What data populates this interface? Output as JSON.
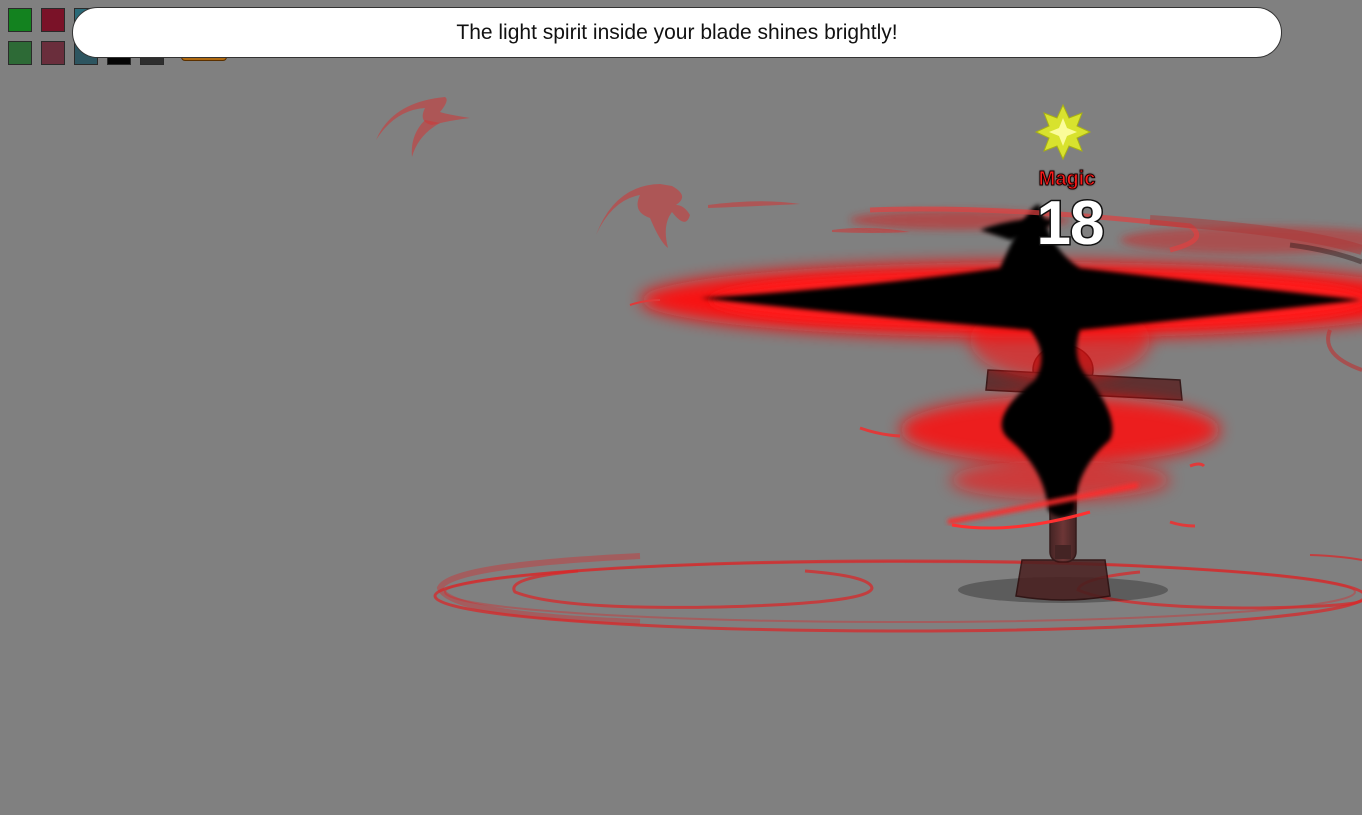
{
  "message": {
    "text": "The light spirit inside your blade shines brightly!"
  },
  "swatches": [
    {
      "name": "swatch-green",
      "color": "#13821f"
    },
    {
      "name": "swatch-crimson",
      "color": "#7a1228"
    },
    {
      "name": "swatch-teal",
      "color": "#2a6a78"
    },
    {
      "name": "swatch-dark-green",
      "color": "#2d6a36"
    },
    {
      "name": "swatch-dark-rose",
      "color": "#6a2e3c"
    },
    {
      "name": "swatch-dark-teal",
      "color": "#2d5560"
    },
    {
      "name": "swatch-black",
      "color": "#050505"
    },
    {
      "name": "swatch-charcoal",
      "color": "#2e2e2e"
    }
  ],
  "damage": {
    "type_label": "Magic",
    "value": "18"
  },
  "colors": {
    "background": "#808080",
    "effect_red": "#ff1010",
    "effect_dark": "#000000",
    "star": "#e6f03a"
  },
  "icons": {
    "star": "light-star-icon",
    "target": "training-dummy"
  }
}
